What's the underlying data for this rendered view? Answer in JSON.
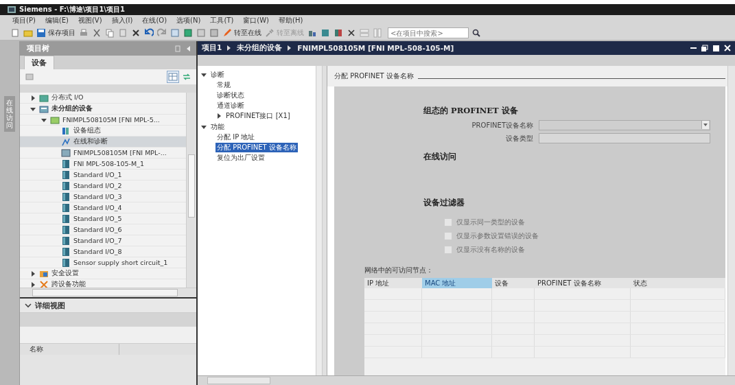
{
  "window": {
    "title": "Siemens - F:\\博途\\项目1\\项目1"
  },
  "menu": [
    "项目(P)",
    "编辑(E)",
    "视图(V)",
    "插入(I)",
    "在线(O)",
    "选项(N)",
    "工具(T)",
    "窗口(W)",
    "帮助(H)"
  ],
  "toolbar": {
    "save_label": "保存项目",
    "go_online_label": "转至在线",
    "go_offline_label": "转至离线",
    "search": {
      "placeholder": "<在项目中搜索>"
    }
  },
  "side_tab": "在线访问",
  "project_tree": {
    "title": "项目树",
    "tab": "设备",
    "items": [
      {
        "label": "分布式 I/O",
        "kind": "folder",
        "expanded": false,
        "selected": false
      },
      {
        "label": "未分组的设备",
        "kind": "group",
        "expanded": true,
        "selected": false,
        "children": [
          {
            "label": "FNIMPL508105M [FNI MPL-5...",
            "kind": "device",
            "expanded": true,
            "selected": false,
            "children": [
              {
                "label": "设备组态",
                "kind": "config",
                "selected": false
              },
              {
                "label": "在线和诊断",
                "kind": "diag",
                "selected": true
              },
              {
                "label": "FNIMPL508105M [FNI MPL-...",
                "kind": "station",
                "selected": false
              },
              {
                "label": "FNI MPL-508-105-M_1",
                "kind": "module",
                "selected": false
              },
              {
                "label": "Standard I/O_1",
                "kind": "module",
                "selected": false
              },
              {
                "label": "Standard I/O_2",
                "kind": "module",
                "selected": false
              },
              {
                "label": "Standard I/O_3",
                "kind": "module",
                "selected": false
              },
              {
                "label": "Standard I/O_4",
                "kind": "module",
                "selected": false
              },
              {
                "label": "Standard I/O_5",
                "kind": "module",
                "selected": false
              },
              {
                "label": "Standard I/O_6",
                "kind": "module",
                "selected": false
              },
              {
                "label": "Standard I/O_7",
                "kind": "module",
                "selected": false
              },
              {
                "label": "Standard I/O_8",
                "kind": "module",
                "selected": false
              },
              {
                "label": "Sensor supply short circuit_1",
                "kind": "module",
                "selected": false
              }
            ]
          }
        ]
      },
      {
        "label": "安全设置",
        "kind": "security",
        "expanded": false,
        "selected": false
      },
      {
        "label": "跨设备功能",
        "kind": "functions",
        "expanded": false,
        "selected": false
      }
    ]
  },
  "details_view": {
    "title": "详细视图",
    "expanded": true,
    "column": "名称"
  },
  "editor": {
    "breadcrumb": [
      "项目1",
      "未分组的设备",
      "FNIMPL508105M [FNI MPL-508-105-M]"
    ],
    "nav": [
      {
        "label": "诊断",
        "expanded": true,
        "selected": false,
        "children": [
          {
            "label": "常规",
            "selected": false
          },
          {
            "label": "诊断状态",
            "selected": false
          },
          {
            "label": "通道诊断",
            "selected": false
          },
          {
            "label": "PROFINET接口 [X1]",
            "expanded": false,
            "selected": false
          }
        ]
      },
      {
        "label": "功能",
        "expanded": true,
        "selected": false,
        "children": [
          {
            "label": "分配 IP 地址",
            "selected": false
          },
          {
            "label": "分配 PROFINET 设备名称",
            "selected": true
          },
          {
            "label": "复位为出厂设置",
            "selected": false
          }
        ]
      }
    ],
    "section_title": "分配 PROFINET 设备名称",
    "configured_heading": "组态的 PROFINET 设备",
    "fields": [
      {
        "label": "PROFINET设备名称",
        "kind": "dropdown"
      },
      {
        "label": "设备类型",
        "kind": "text"
      }
    ],
    "online_heading": "在线访问",
    "filter_heading": "设备过滤器",
    "filters": [
      {
        "label": "仅显示同一类型的设备",
        "checked": false,
        "disabled": true
      },
      {
        "label": "仅显示参数设置错误的设备",
        "checked": false,
        "disabled": true
      },
      {
        "label": "仅显示没有名称的设备",
        "checked": false,
        "disabled": true
      }
    ],
    "table_caption": "网络中的可访问节点：",
    "columns": [
      {
        "label": "IP 地址",
        "selected": false
      },
      {
        "label": "MAC 地址",
        "selected": true
      },
      {
        "label": "设备",
        "selected": false
      },
      {
        "label": "PROFINET 设备名称",
        "selected": false
      },
      {
        "label": "状态",
        "selected": false
      }
    ]
  }
}
